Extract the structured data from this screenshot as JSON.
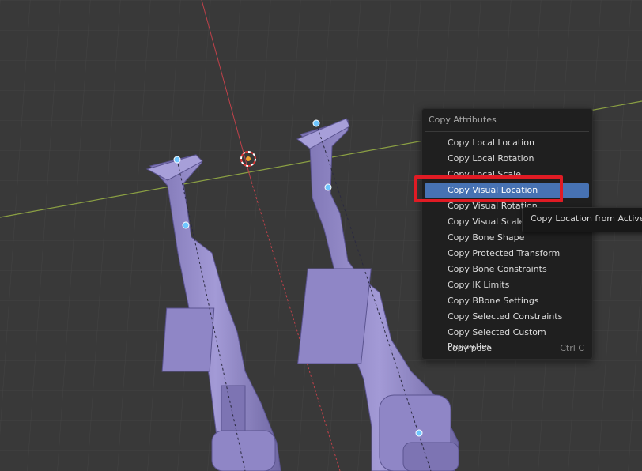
{
  "menu": {
    "title": "Copy Attributes",
    "items": [
      {
        "label": "Copy Local Location",
        "shortcut": ""
      },
      {
        "label": "Copy Local Rotation",
        "shortcut": ""
      },
      {
        "label": "Copy Local Scale",
        "shortcut": ""
      },
      {
        "label": "Copy Visual Location",
        "shortcut": "",
        "state": "hovered"
      },
      {
        "label": "Copy Visual Rotation",
        "shortcut": ""
      },
      {
        "label": "Copy Visual Scale",
        "shortcut": ""
      },
      {
        "label": "Copy Bone Shape",
        "shortcut": ""
      },
      {
        "label": "Copy Protected Transform",
        "shortcut": ""
      },
      {
        "label": "Copy Bone Constraints",
        "shortcut": ""
      },
      {
        "label": "Copy IK Limits",
        "shortcut": ""
      },
      {
        "label": "Copy BBone Settings",
        "shortcut": ""
      },
      {
        "label": "Copy Selected Constraints",
        "shortcut": ""
      },
      {
        "label": "Copy Selected Custom Properties",
        "shortcut": ""
      },
      {
        "label": "copy pose",
        "shortcut": "Ctrl C"
      }
    ]
  },
  "tooltip": {
    "text": "Copy Location from Active to"
  },
  "viewport": {
    "background": "#393939",
    "grid_color": "#444444",
    "x_axis_color": "#8ba043",
    "y_axis_color": "#c0414a",
    "mesh_color": "#8f86c6",
    "highlight_color": "#e01b24",
    "active_item_color": "#4772b3"
  }
}
